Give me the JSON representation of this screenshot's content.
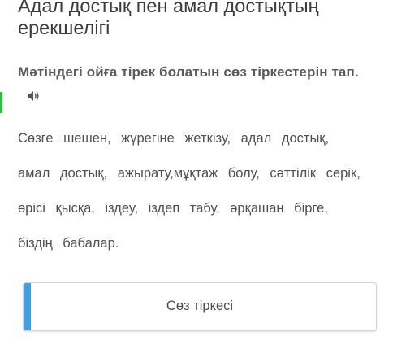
{
  "header": {
    "title": "Адал достық пен амал достықтың ерекшелігі"
  },
  "task": {
    "instruction": "Мәтіндегі ойға тірек болатын сөз тіркестерін тап.",
    "audio_icon": "speaker-icon"
  },
  "passage": {
    "lines": [
      "Сөзге шешен, жүрегіне жеткізу, адал достық,",
      "амал достық, ажырату,мұқтаж болу, сәттілік серік,",
      "өрісі қысқа, іздеу, іздеп табу, әрқашан бірге,",
      "біздің бабалар."
    ]
  },
  "drop_zone": {
    "label": "Сөз тіркесі"
  },
  "colors": {
    "accent_blue": "#3ea2e6",
    "accent_green": "#3bb54a",
    "text": "#4a4a4a"
  }
}
